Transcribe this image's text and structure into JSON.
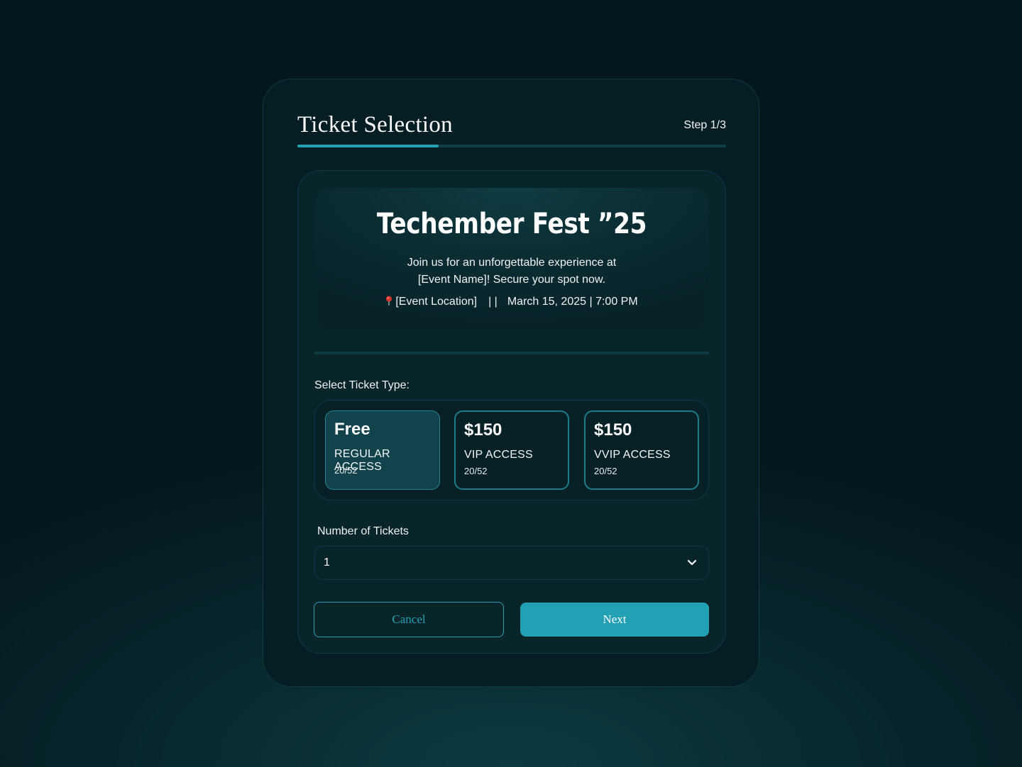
{
  "header": {
    "title": "Ticket Selection",
    "step": "Step 1/3",
    "progress": 0.33
  },
  "event": {
    "title": "Techember Fest ”25",
    "description": "Join us for an unforgettable experience at [Event Name]! Secure your spot now.",
    "location": "[Event Location]",
    "separator": "| |",
    "datetime": "March 15, 2025 | 7:00 PM"
  },
  "ticket_type": {
    "label": "Select Ticket Type:",
    "options": [
      {
        "price": "Free",
        "access": "REGULAR ACCESS",
        "availability": "20/52",
        "selected": true
      },
      {
        "price": "$150",
        "access": "VIP ACCESS",
        "availability": "20/52",
        "selected": false
      },
      {
        "price": "$150",
        "access": "VVIP ACCESS",
        "availability": "20/52",
        "selected": false
      }
    ]
  },
  "quantity": {
    "label": "Number of Tickets",
    "value": "1"
  },
  "actions": {
    "cancel_label": "Cancel",
    "next_label": "Next"
  },
  "colors": {
    "accent": "#24a0b5",
    "background": "#041e23",
    "pin": "#d9342b"
  },
  "icons": {
    "location": "map-pin-icon",
    "dropdown": "chevron-down-icon"
  }
}
